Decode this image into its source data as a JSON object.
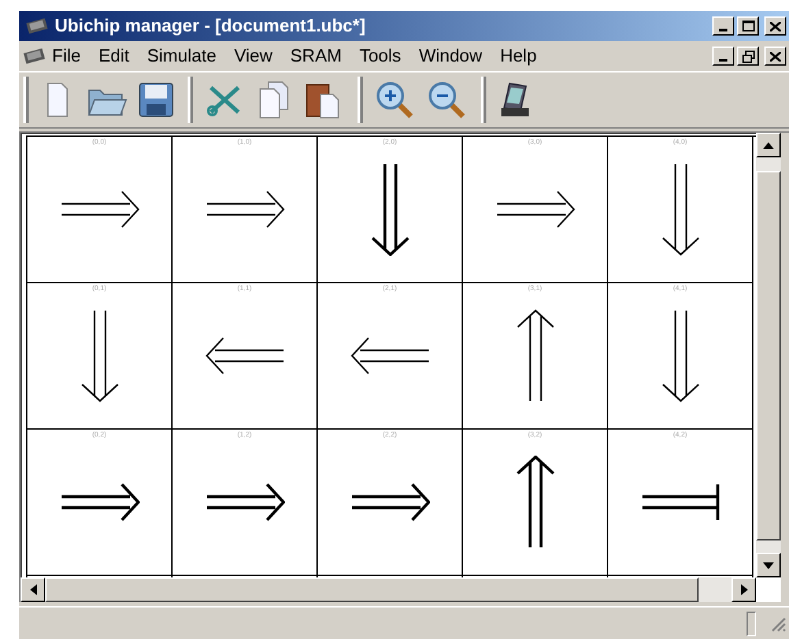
{
  "window": {
    "title": "Ubichip manager - [document1.ubc*]"
  },
  "menu": [
    "File",
    "Edit",
    "Simulate",
    "View",
    "SRAM",
    "Tools",
    "Window",
    "Help"
  ],
  "grid": {
    "rows": [
      [
        {
          "label": "(0,0)",
          "kind": "right",
          "bold": false
        },
        {
          "label": "(1,0)",
          "kind": "right",
          "bold": false
        },
        {
          "label": "(2,0)",
          "kind": "down",
          "bold": true
        },
        {
          "label": "(3,0)",
          "kind": "right",
          "bold": false
        },
        {
          "label": "(4,0)",
          "kind": "down",
          "bold": false
        }
      ],
      [
        {
          "label": "(0,1)",
          "kind": "down",
          "bold": false
        },
        {
          "label": "(1,1)",
          "kind": "left",
          "bold": false
        },
        {
          "label": "(2,1)",
          "kind": "left",
          "bold": false
        },
        {
          "label": "(3,1)",
          "kind": "up",
          "bold": false
        },
        {
          "label": "(4,1)",
          "kind": "down",
          "bold": false
        }
      ],
      [
        {
          "label": "(0,2)",
          "kind": "right",
          "bold": true
        },
        {
          "label": "(1,2)",
          "kind": "right",
          "bold": true
        },
        {
          "label": "(2,2)",
          "kind": "right",
          "bold": true
        },
        {
          "label": "(3,2)",
          "kind": "up",
          "bold": true
        },
        {
          "label": "(4,2)",
          "kind": "stop",
          "bold": true
        }
      ]
    ]
  }
}
